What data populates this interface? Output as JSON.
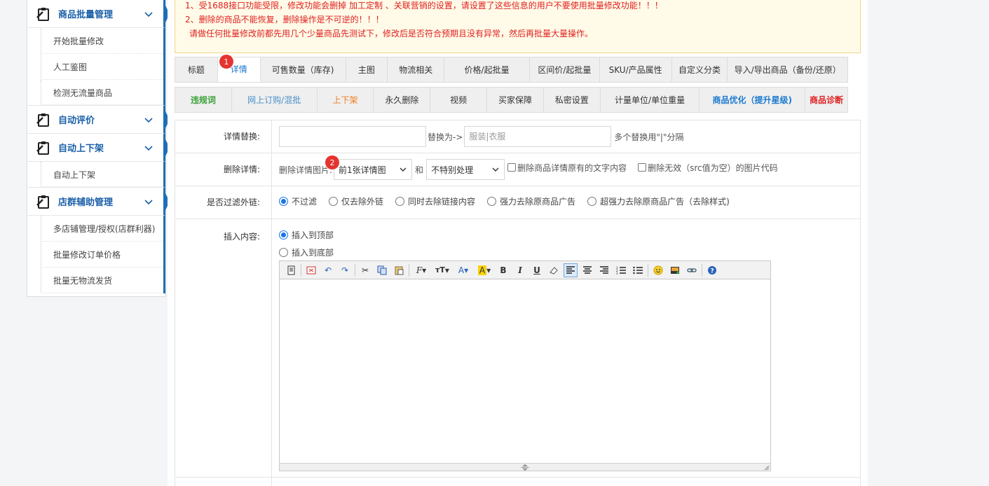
{
  "sidebar": {
    "groups": [
      {
        "title": "商品批量管理",
        "items": [
          "开始批量修改",
          "人工鉴图",
          "检测无流量商品"
        ]
      },
      {
        "title": "自动评价",
        "items": []
      },
      {
        "title": "自动上下架",
        "items": [
          "自动上下架"
        ]
      },
      {
        "title": "店群辅助管理",
        "items": [
          "多店铺管理/授权(店群利器)",
          "批量修改订单价格",
          "批量无物流发货"
        ]
      }
    ]
  },
  "notice": {
    "line1": "1、受1688接口功能受限，修改功能会删掉 加工定制 、关联营销的设置，请设置了这些信息的用户不要使用批量修改功能！！！",
    "line2": "2、删除的商品不能恢复，删除操作是不可逆的！！！",
    "line3": "请做任何批量修改前都先用几个少量商品先测试下，修改后是否符合预期且没有异常，然后再批量大量操作。"
  },
  "tabs_row1": {
    "badge": "1",
    "items": [
      "标题",
      "详情",
      "可售数量（库存)",
      "主图",
      "物流相关",
      "价格/起批量",
      "区间价/起批量",
      "SKU/产品属性",
      "自定义分类",
      "导入/导出商品（备份/还原）"
    ]
  },
  "tabs_row2": {
    "items": [
      "违规词",
      "网上订购/混批",
      "上下架",
      "永久删除",
      "视频",
      "买家保障",
      "私密设置",
      "计量单位/单位重量",
      "商品优化（提升星级)",
      "商品诊断"
    ],
    "colors": [
      "#3aa23a",
      "#4a90c8",
      "#f07c1c",
      "#333333",
      "#333333",
      "#333333",
      "#333333",
      "#333333",
      "#1a7ad0",
      "#e02020"
    ]
  },
  "form": {
    "replace": {
      "label": "详情替换:",
      "find_value": "",
      "arrow_text": "替换为->",
      "replace_placeholder": "服装|衣服",
      "hint": "多个替换用\"|\"分隔"
    },
    "delete": {
      "label": "删除详情:",
      "prefix": "删除详情图片:",
      "badge": "2",
      "select1": "前1张详情图",
      "and_text": "和",
      "select2": "不特别处理",
      "check1": "删除商品详情原有的文字内容",
      "check2": "删除无效（src值为空）的图片代码"
    },
    "filter": {
      "label": "是否过滤外链:",
      "options": [
        "不过滤",
        "仅去除外链",
        "同时去除链接内容",
        "强力去除原商品广告",
        "超强力去除原商品广告（去除样式)"
      ],
      "selected": 0
    },
    "insert": {
      "label": "插入内容:",
      "options": [
        "插入到顶部",
        "插入到底部"
      ],
      "selected": 0
    }
  },
  "colors": {
    "accent": "#1e6fb5",
    "notice_text": "#e02020",
    "badge": "#e5342f"
  }
}
